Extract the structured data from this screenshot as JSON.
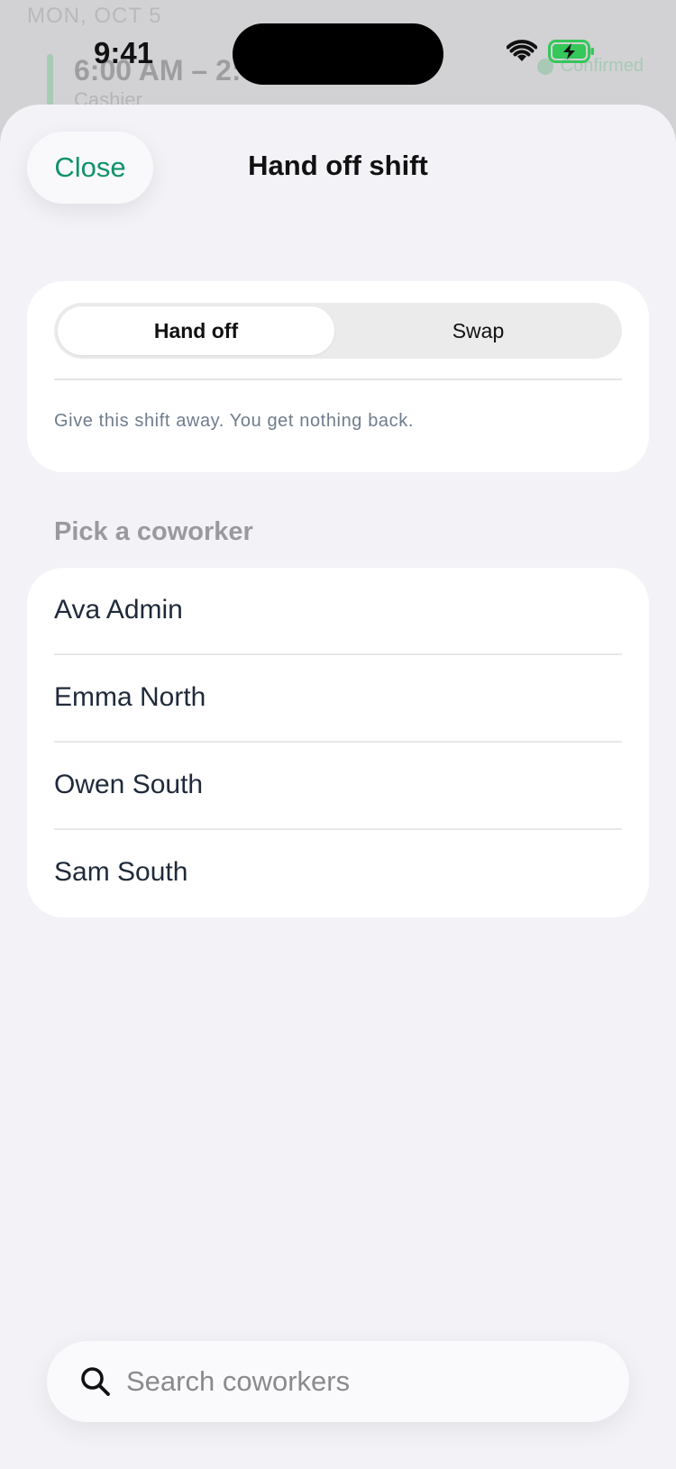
{
  "status_bar": {
    "time": "9:41",
    "icons": [
      "wifi-icon",
      "battery-charging-icon"
    ]
  },
  "background": {
    "date_label": "MON, OCT 5",
    "shift_time": "6:00 AM – 2:",
    "shift_sub": "Cashier",
    "status_label": "Confirmed"
  },
  "sheet": {
    "close_label": "Close",
    "title": "Hand off shift",
    "mode": {
      "options": [
        "Hand off",
        "Swap"
      ],
      "selected": "Hand off",
      "description": "Give this shift away. You get nothing back."
    },
    "section_header": "Pick a coworker",
    "coworkers": [
      "Ava Admin",
      "Emma North",
      "Owen South",
      "Sam South"
    ],
    "search": {
      "value": "",
      "placeholder": "Search coworkers",
      "icon": "search-icon"
    }
  },
  "colors": {
    "accent": "#0f9367",
    "sheet_background": "#f2f2f7",
    "card_background": "#ffffff",
    "description_text": "#6f7c8c",
    "battery_charging": "#34c759"
  }
}
